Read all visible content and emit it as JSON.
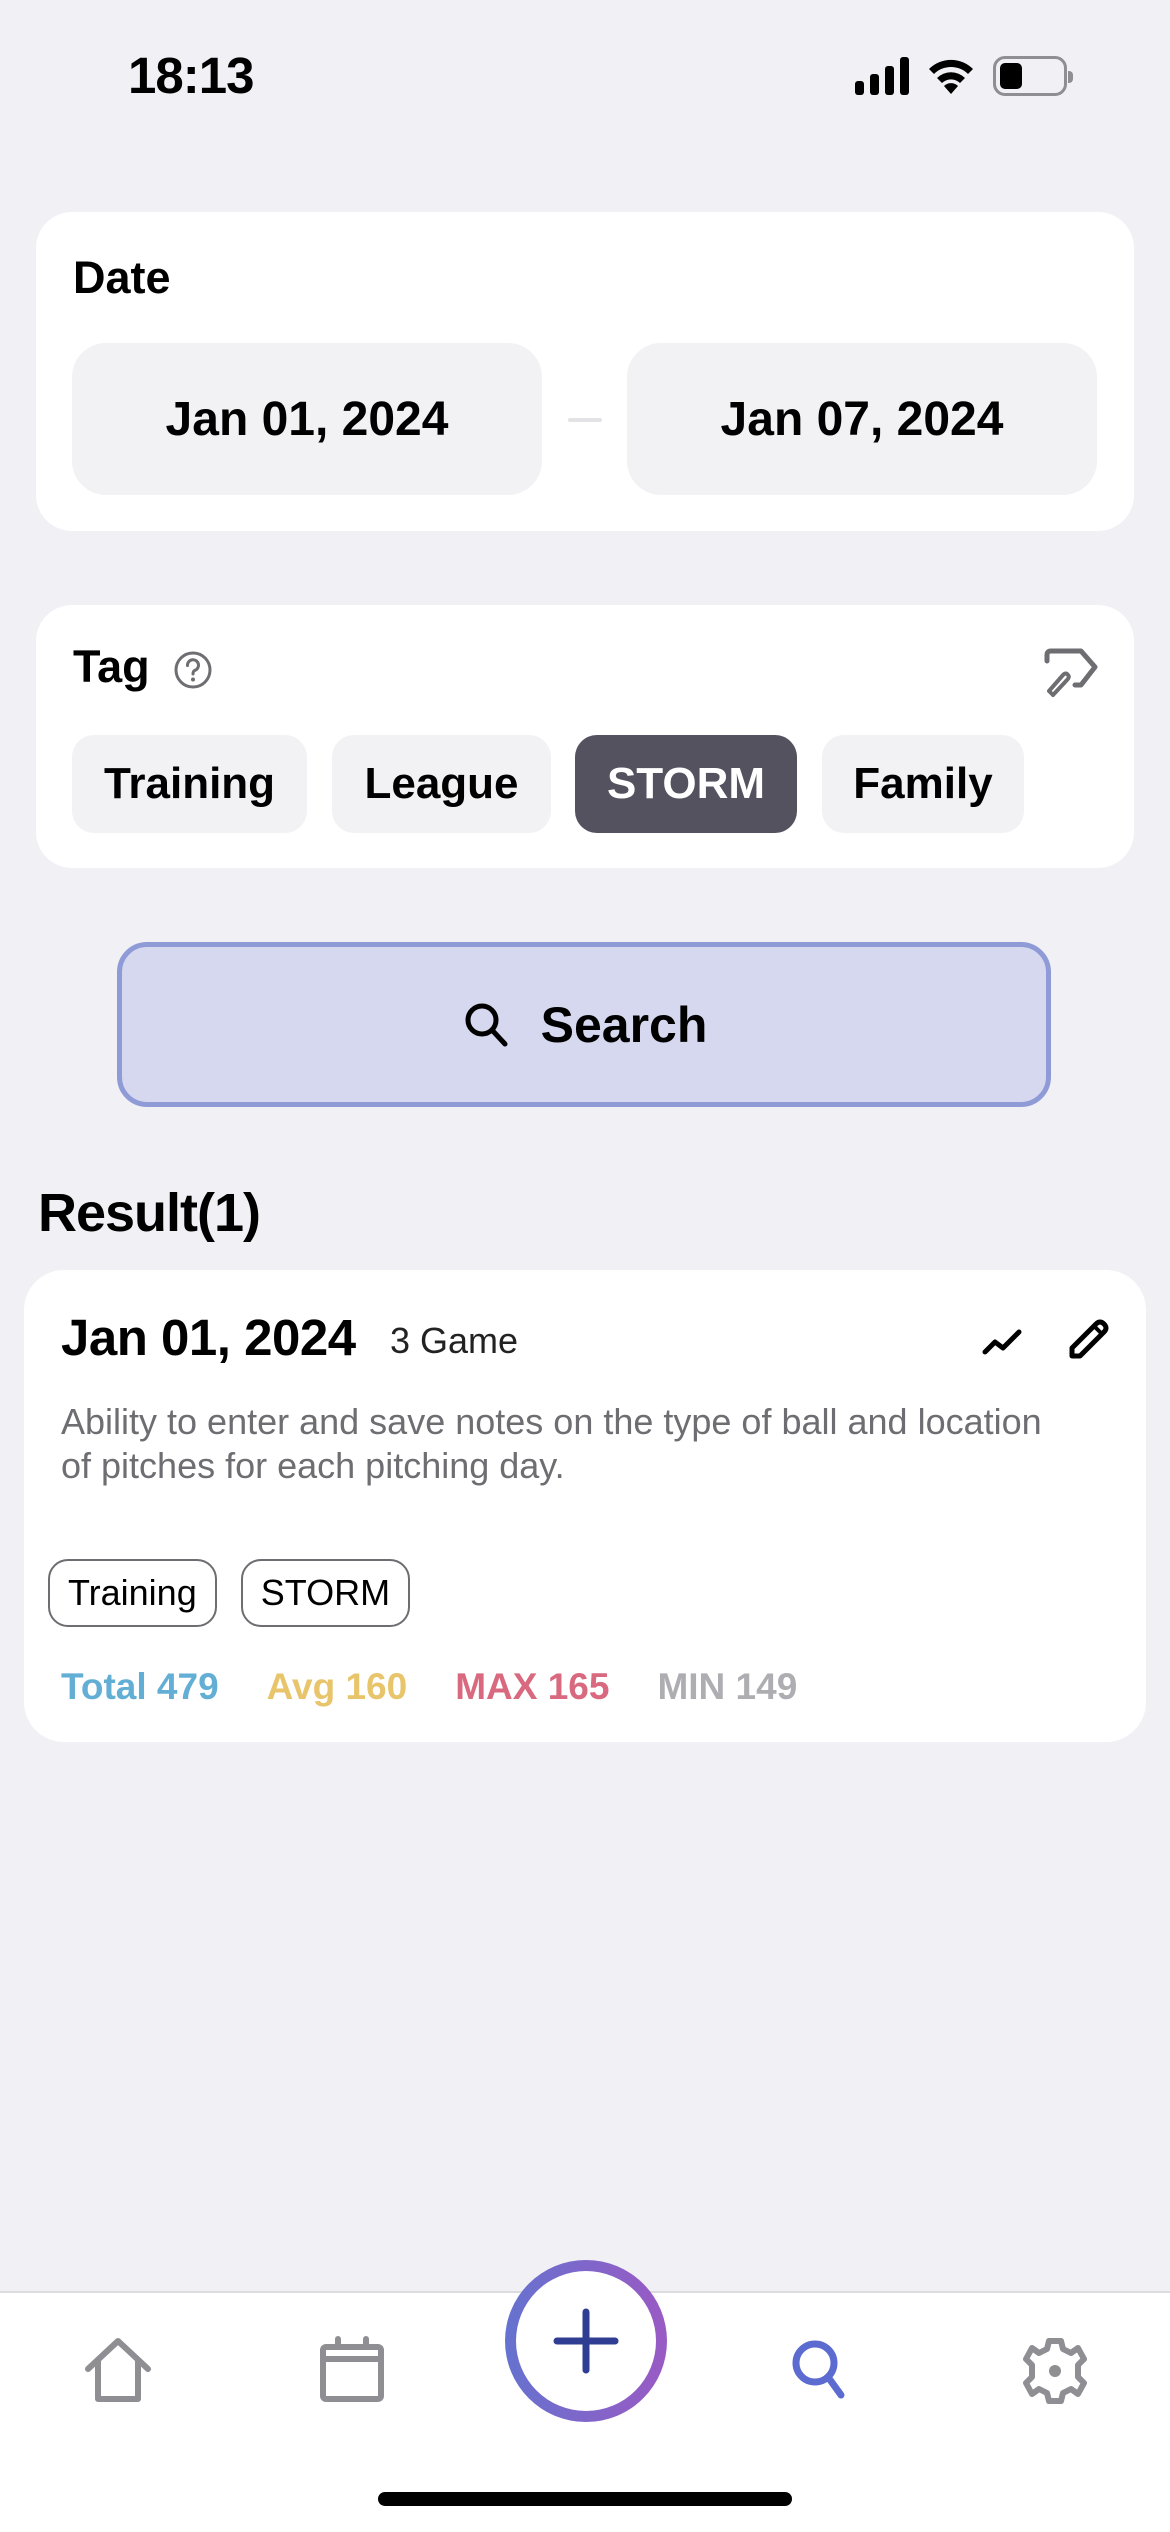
{
  "status_bar": {
    "time": "18:13",
    "icons": [
      "cellular-signal-icon",
      "wifi-icon",
      "battery-icon"
    ],
    "battery_level": 0.3
  },
  "date_filter": {
    "title": "Date",
    "from": "Jan 01, 2024",
    "to": "Jan 07, 2024"
  },
  "tag_filter": {
    "title": "Tag",
    "help_icon": "question-circle-icon",
    "edit_icon": "tag-edit-icon",
    "tags": [
      {
        "label": "Training",
        "selected": false
      },
      {
        "label": "League",
        "selected": false
      },
      {
        "label": "STORM",
        "selected": true
      },
      {
        "label": "Family",
        "selected": false
      }
    ]
  },
  "search_button": {
    "label": "Search",
    "icon": "search-icon"
  },
  "results": {
    "title": "Result(1)",
    "items": [
      {
        "date": "Jan 01, 2024",
        "games": "3 Game",
        "note": "Ability to enter and save notes on the type of ball and location of pitches for each pitching day.",
        "tags": [
          "Training",
          "STORM"
        ],
        "stats": {
          "total": "Total 479",
          "avg": "Avg 160",
          "max": "MAX 165",
          "min": "MIN 149"
        }
      }
    ]
  },
  "colors": {
    "background": "#f1f0f5",
    "selected_chip": "#53525e",
    "search_bg": "#d6d8ef",
    "search_border": "#8f9bd6",
    "total": "#63aed4",
    "avg": "#e8c46a",
    "max": "#d8697e",
    "min": "#aeaeb2",
    "tab_active": "#5b6bd0",
    "tab_inactive": "#8e8e93"
  },
  "tab_bar": {
    "items": [
      {
        "name": "home",
        "icon": "home-icon",
        "active": false
      },
      {
        "name": "calendar",
        "icon": "calendar-icon",
        "active": false
      },
      {
        "name": "add",
        "icon": "plus-icon",
        "active": false
      },
      {
        "name": "search",
        "icon": "search-icon",
        "active": true
      },
      {
        "name": "settings",
        "icon": "gear-icon",
        "active": false
      }
    ]
  }
}
